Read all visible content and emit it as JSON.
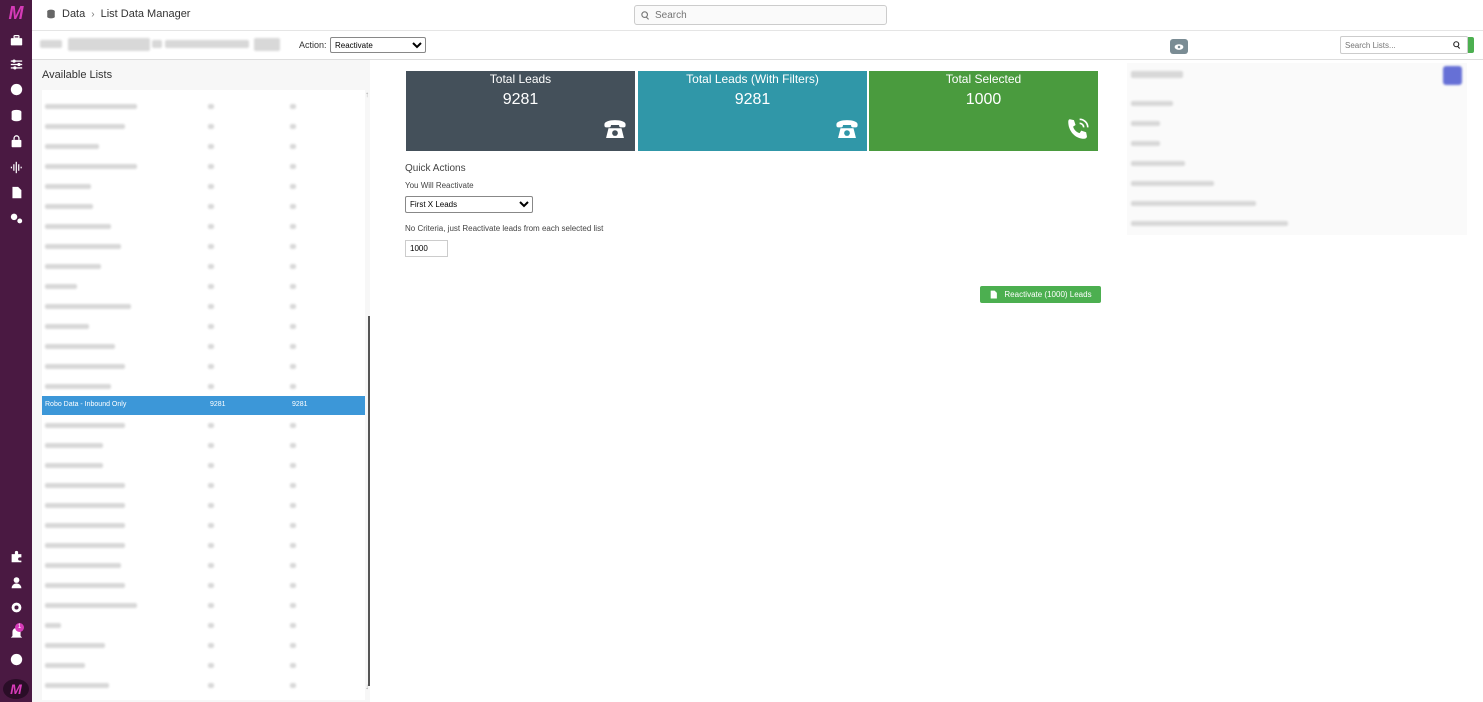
{
  "header": {
    "breadcrumb_root": "Data",
    "breadcrumb_current": "List Data Manager",
    "search_placeholder": "Search"
  },
  "toolbar": {
    "action_label": "Action:",
    "action_selected": "Reactivate",
    "search_lists_placeholder": "Search Lists..."
  },
  "sidebar": {
    "notification_count": "1"
  },
  "lists": {
    "title": "Available Lists",
    "selected": {
      "name": "Robo Data - Inbound Only",
      "count1": "9281",
      "count2": "9281"
    }
  },
  "stats": {
    "total_leads_title": "Total Leads",
    "total_leads_value": "9281",
    "filtered_title": "Total Leads (With Filters)",
    "filtered_value": "9281",
    "selected_title": "Total Selected",
    "selected_value": "1000"
  },
  "quick_actions": {
    "title": "Quick Actions",
    "label": "You Will Reactivate",
    "mode_selected": "First X Leads",
    "note": "No Criteria, just Reactivate leads from each selected list",
    "amount": "1000",
    "button_label": "Reactivate (1000) Leads"
  },
  "colors": {
    "rail": "#4a1942",
    "card_total": "#44505a",
    "card_filtered": "#3097a8",
    "card_selected": "#4a9b3e",
    "selected_row": "#3c97d8",
    "action_green": "#4caf50"
  }
}
